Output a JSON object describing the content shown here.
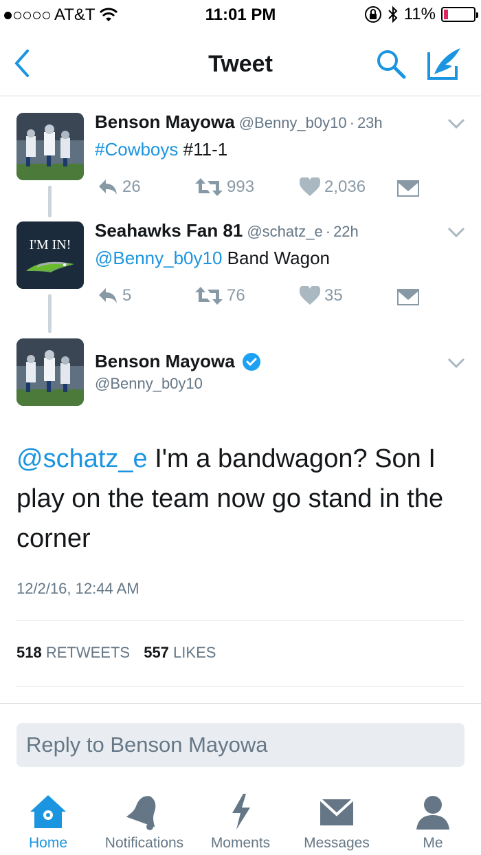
{
  "status_bar": {
    "carrier": "AT&T",
    "time": "11:01 PM",
    "battery": "11%"
  },
  "nav": {
    "title": "Tweet"
  },
  "thread": [
    {
      "name": "Benson Mayowa",
      "handle": "@Benny_b0y10",
      "time": "23h",
      "text_parts": {
        "hashtag": "#Cowboys",
        "rest": " #11-1"
      },
      "replies": "26",
      "retweets": "993",
      "likes": "2,036"
    },
    {
      "name": "Seahawks Fan 81",
      "handle": "@schatz_e",
      "time": "22h",
      "avatar_text": "I'M IN!",
      "text_parts": {
        "mention": "@Benny_b0y10",
        "rest": " Band Wagon"
      },
      "replies": "5",
      "retweets": "76",
      "likes": "35"
    }
  ],
  "main_tweet": {
    "name": "Benson Mayowa",
    "handle": "@Benny_b0y10",
    "mention": "@schatz_e",
    "text": " I'm a bandwagon? Son I play on the team now go stand in the corner",
    "date": "12/2/16, 12:44 AM",
    "retweets_count": "518",
    "retweets_label": "RETWEETS",
    "likes_count": "557",
    "likes_label": "LIKES"
  },
  "reply": {
    "placeholder": "Reply to Benson Mayowa"
  },
  "tabs": [
    {
      "label": "Home",
      "icon": "home-icon",
      "active": true
    },
    {
      "label": "Notifications",
      "icon": "bell-icon"
    },
    {
      "label": "Moments",
      "icon": "lightning-icon"
    },
    {
      "label": "Messages",
      "icon": "envelope-icon"
    },
    {
      "label": "Me",
      "icon": "person-icon"
    }
  ],
  "colors": {
    "accent": "#1b95e0",
    "text": "#14171a",
    "muted": "#657786",
    "icon_gray": "#8899a6",
    "verified": "#1da1f2"
  }
}
